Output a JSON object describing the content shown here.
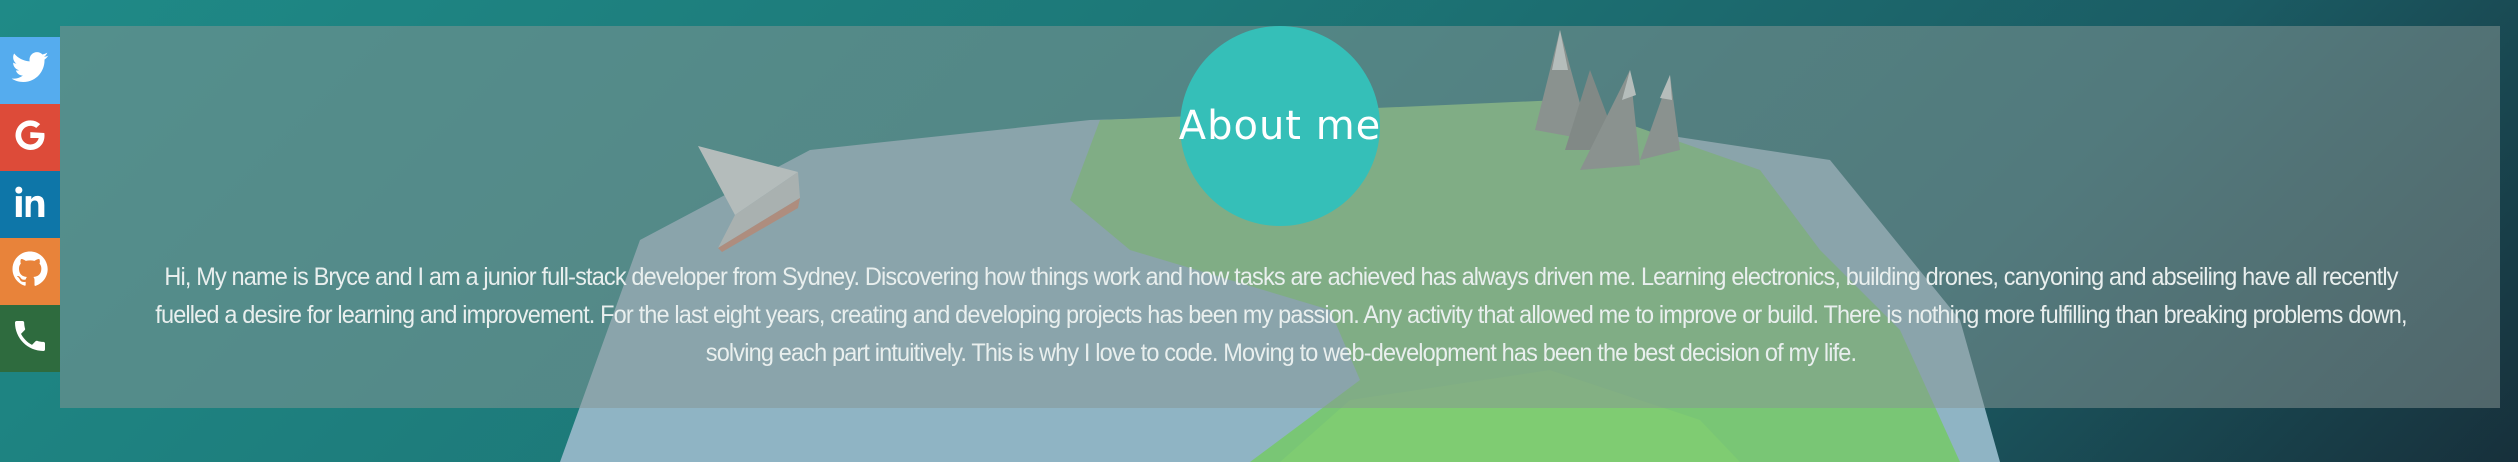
{
  "social": [
    {
      "name": "twitter",
      "icon": "twitter-icon",
      "color": "#55acee"
    },
    {
      "name": "google",
      "icon": "google-icon",
      "color": "#dd4b39"
    },
    {
      "name": "linkedin",
      "icon": "linkedin-icon",
      "color": "#0e76a8"
    },
    {
      "name": "github",
      "icon": "github-icon",
      "color": "#e8833a"
    },
    {
      "name": "phone",
      "icon": "phone-icon",
      "color": "#2e6b3e"
    }
  ],
  "about": {
    "title": "About me",
    "text": "Hi, My name is Bryce and I am a junior full-stack developer from Sydney. Discovering how things work and how tasks are achieved has always driven me. Learning electronics, building drones, canyoning and abseiling have all recently fuelled a desire for learning and improvement. For the last eight years, creating and developing projects has been my passion. Any activity that allowed me to improve or build. There is nothing more fulfilling than breaking problems down, solving each part intuitively. This is why I love to code. Moving to web-development has been the best decision of my life."
  },
  "colors": {
    "accent_circle": "#35bfb8",
    "panel_overlay": "#879694"
  }
}
